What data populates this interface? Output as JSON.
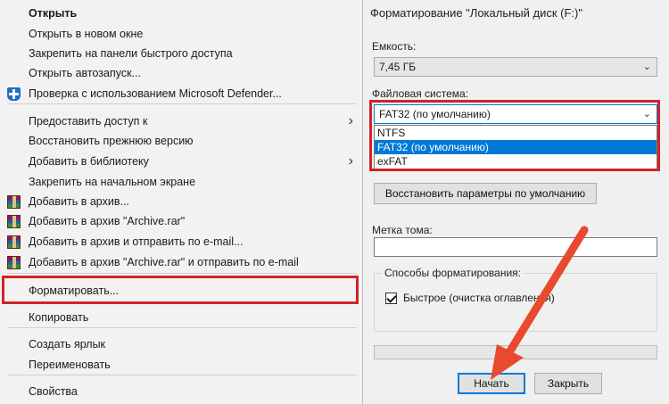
{
  "context_menu": {
    "items": [
      {
        "label": "Открыть",
        "bold": true
      },
      {
        "label": "Открыть в новом окне"
      },
      {
        "label": "Закрепить на панели быстрого доступа"
      },
      {
        "label": "Открыть автозапуск..."
      },
      {
        "label": "Проверка с использованием Microsoft Defender...",
        "icon": "defender-shield-icon"
      },
      {
        "label": "Предоставить доступ к",
        "submenu": true
      },
      {
        "label": "Восстановить прежнюю версию"
      },
      {
        "label": "Добавить в библиотеку",
        "submenu": true
      },
      {
        "label": "Закрепить на начальном экране"
      },
      {
        "label": "Добавить в архив...",
        "icon": "winrar-archive-icon"
      },
      {
        "label": "Добавить в архив \"Archive.rar\"",
        "icon": "winrar-archive-icon"
      },
      {
        "label": "Добавить в архив и отправить по e-mail...",
        "icon": "winrar-archive-icon"
      },
      {
        "label": "Добавить в архив \"Archive.rar\" и отправить по e-mail",
        "icon": "winrar-archive-icon"
      },
      {
        "label": "Форматировать...",
        "highlighted": true
      },
      {
        "label": "Копировать"
      },
      {
        "label": "Создать ярлык"
      },
      {
        "label": "Переименовать"
      },
      {
        "label": "Свойства"
      }
    ]
  },
  "dialog": {
    "title": "Форматирование \"Локальный диск (F:)\"",
    "capacity_label": "Емкость:",
    "capacity_value": "7,45 ГБ",
    "fs_label": "Файловая система:",
    "fs_value": "FAT32 (по умолчанию)",
    "fs_options": [
      "NTFS",
      "FAT32 (по умолчанию)",
      "exFAT"
    ],
    "fs_selected_index": 1,
    "restore_defaults_button": "Восстановить параметры по умолчанию",
    "volume_label": "Метка тома:",
    "volume_value": "",
    "format_options_label": "Способы форматирования:",
    "quick_format_label": "Быстрое (очистка оглавления)",
    "quick_format_checked": true,
    "start_button": "Начать",
    "close_button": "Закрыть"
  },
  "annotation": {
    "highlight_color": "#d1232a",
    "arrow_color": "#e8492f"
  }
}
